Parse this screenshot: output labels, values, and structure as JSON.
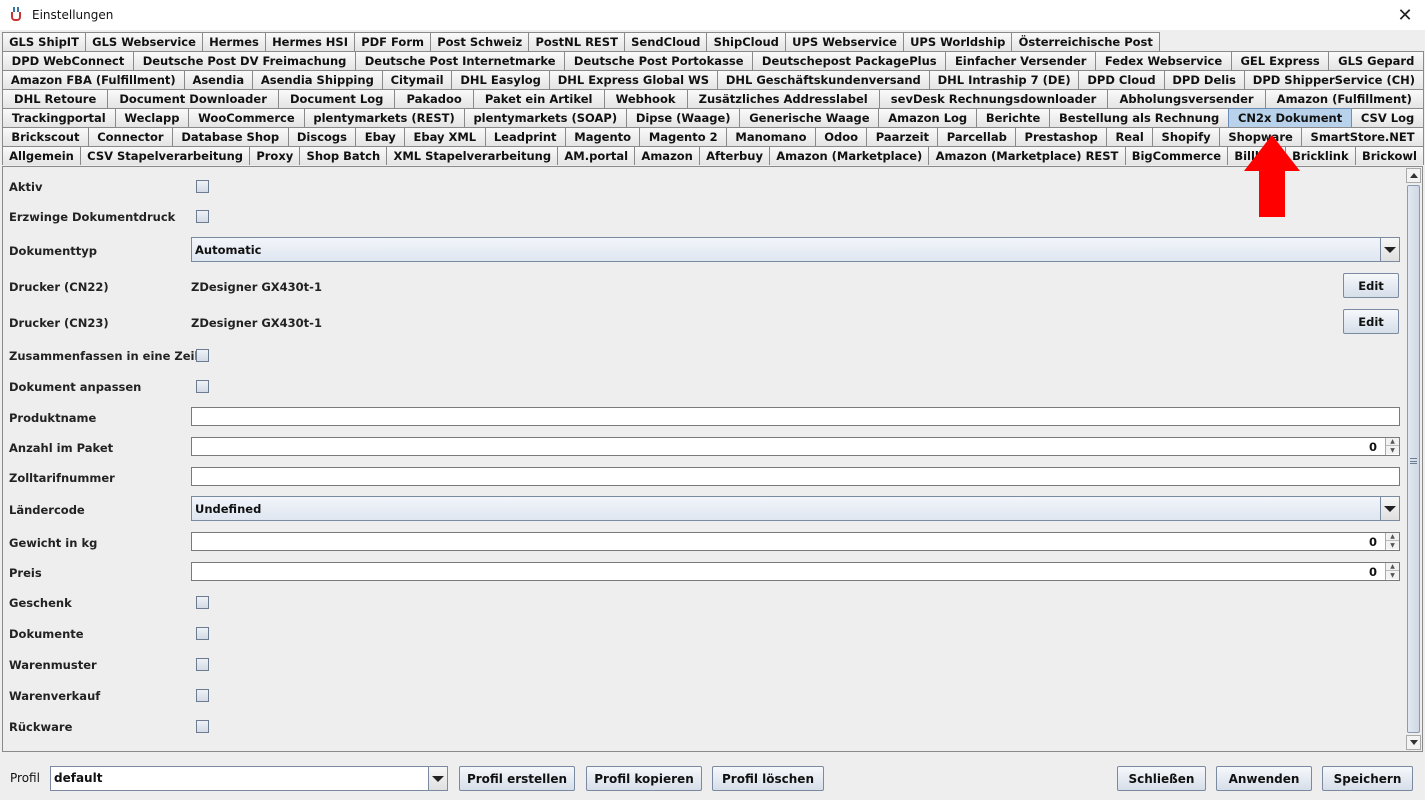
{
  "window": {
    "title": "Einstellungen",
    "close_label": "✕"
  },
  "tabs": {
    "rows": [
      [
        "GLS ShipIT",
        "GLS Webservice",
        "Hermes",
        "Hermes HSI",
        "PDF Form",
        "Post Schweiz",
        "PostNL REST",
        "SendCloud",
        "ShipCloud",
        "UPS Webservice",
        "UPS Worldship",
        "Österreichische Post"
      ],
      [
        "DPD WebConnect",
        "Deutsche Post DV Freimachung",
        "Deutsche Post Internetmarke",
        "Deutsche Post Portokasse",
        "Deutschepost PackagePlus",
        "Einfacher Versender",
        "Fedex Webservice",
        "GEL Express",
        "GLS Gepard"
      ],
      [
        "Amazon FBA (Fulfillment)",
        "Asendia",
        "Asendia Shipping",
        "Citymail",
        "DHL Easylog",
        "DHL Express Global WS",
        "DHL Geschäftskundenversand",
        "DHL Intraship 7 (DE)",
        "DPD Cloud",
        "DPD Delis",
        "DPD ShipperService (CH)"
      ],
      [
        "DHL Retoure",
        "Document Downloader",
        "Document Log",
        "Pakadoo",
        "Paket ein Artikel",
        "Webhook",
        "Zusätzliches Addresslabel",
        "sevDesk Rechnungsdownloader",
        "Abholungsversender",
        "Amazon (Fulfillment)"
      ],
      [
        "Trackingportal",
        "Weclapp",
        "WooCommerce",
        "plentymarkets (REST)",
        "plentymarkets (SOAP)",
        "Dipse (Waage)",
        "Generische Waage",
        "Amazon Log",
        "Berichte",
        "Bestellung als Rechnung",
        "CN2x Dokument",
        "CSV Log"
      ],
      [
        "Brickscout",
        "Connector",
        "Database Shop",
        "Discogs",
        "Ebay",
        "Ebay XML",
        "Leadprint",
        "Magento",
        "Magento 2",
        "Manomano",
        "Odoo",
        "Paarzeit",
        "Parcellab",
        "Prestashop",
        "Real",
        "Shopify",
        "Shopware",
        "SmartStore.NET"
      ],
      [
        "Allgemein",
        "CSV Stapelverarbeitung",
        "Proxy",
        "Shop Batch",
        "XML Stapelverarbeitung",
        "AM.portal",
        "Amazon",
        "Afterbuy",
        "Amazon (Marketplace)",
        "Amazon (Marketplace) REST",
        "BigCommerce",
        "Billbee",
        "Bricklink",
        "Brickowl"
      ]
    ],
    "active": "CN2x Dokument",
    "active_color": "#b9d2ec"
  },
  "form": {
    "aktiv": "Aktiv",
    "erzwinge": "Erzwinge Dokumentdruck",
    "dokumenttyp": "Dokumenttyp",
    "dokumenttyp_value": "Automatic",
    "drucker_cn22": "Drucker (CN22)",
    "drucker_cn22_value": "ZDesigner GX430t-1",
    "drucker_cn23": "Drucker (CN23)",
    "drucker_cn23_value": "ZDesigner GX430t-1",
    "edit_label": "Edit",
    "zusammenfassen": "Zusammenfassen in eine Zeile",
    "dokument_anpassen": "Dokument anpassen",
    "produktname": "Produktname",
    "produktname_value": "",
    "anzahl": "Anzahl im Paket",
    "anzahl_value": "0",
    "zolltarif": "Zolltarifnummer",
    "zolltarif_value": "",
    "laendercode": "Ländercode",
    "laendercode_value": "Undefined",
    "gewicht": "Gewicht in kg",
    "gewicht_value": "0",
    "preis": "Preis",
    "preis_value": "0",
    "geschenk": "Geschenk",
    "dokumente": "Dokumente",
    "warenmuster": "Warenmuster",
    "warenverkauf": "Warenverkauf",
    "rueckware": "Rückware"
  },
  "footer": {
    "profil_label": "Profil",
    "profil_value": "default",
    "profil_erstellen": "Profil erstellen",
    "profil_kopieren": "Profil kopieren",
    "profil_loeschen": "Profil löschen",
    "schliessen": "Schließen",
    "anwenden": "Anwenden",
    "speichern": "Speichern"
  },
  "annotation": {
    "arrow_color": "#ff0000"
  }
}
